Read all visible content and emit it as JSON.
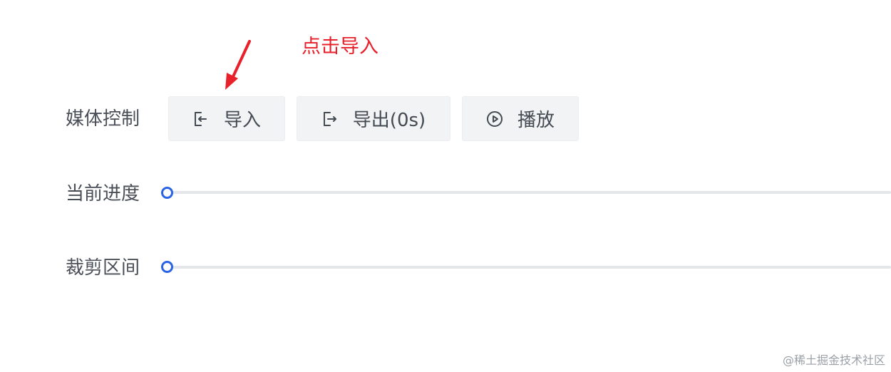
{
  "annotation": {
    "text": "点击导入",
    "color": "#e8202a"
  },
  "media_control": {
    "label": "媒体控制",
    "buttons": [
      {
        "label": "导入",
        "icon": "import-icon"
      },
      {
        "label": "导出(0s)",
        "icon": "export-icon"
      },
      {
        "label": "播放",
        "icon": "play-circle-icon"
      }
    ]
  },
  "progress": {
    "label": "当前进度",
    "value": 0
  },
  "trim_range": {
    "label": "裁剪区间",
    "value": 0
  },
  "watermark": "@稀土掘金技术社区",
  "colors": {
    "accent": "#2a63e3",
    "button_bg": "#f1f3f5",
    "label_text": "#4a4f57"
  }
}
